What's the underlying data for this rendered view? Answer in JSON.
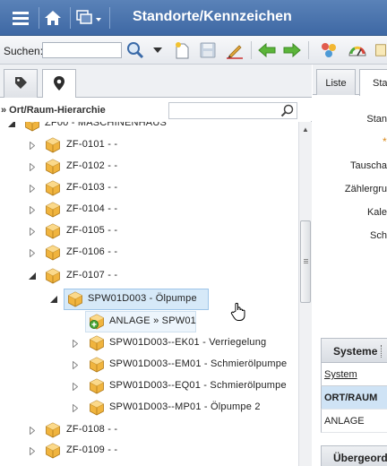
{
  "titlebar": {
    "title": "Standorte/Kennzeichen"
  },
  "toolbar": {
    "search_label": "Suchen:",
    "search_value": ""
  },
  "left_tabs": [
    {
      "icon": "tag-icon",
      "active": false
    },
    {
      "icon": "location-pin-icon",
      "active": true
    }
  ],
  "hierarchy": {
    "title": "» Ort/Raum-Hierarchie",
    "filter_value": "",
    "nodes": [
      {
        "id": "zf00",
        "label": "ZF00 - MASCHINENHAUS",
        "expander": "expanded"
      },
      {
        "id": "zf0101",
        "label": "ZF-0101 - -",
        "expander": "collapsed"
      },
      {
        "id": "zf0102",
        "label": "ZF-0102 - -",
        "expander": "collapsed"
      },
      {
        "id": "zf0103",
        "label": "ZF-0103 - -",
        "expander": "collapsed"
      },
      {
        "id": "zf0104",
        "label": "ZF-0104 - -",
        "expander": "collapsed"
      },
      {
        "id": "zf0105",
        "label": "ZF-0105 - -",
        "expander": "collapsed"
      },
      {
        "id": "zf0106",
        "label": "ZF-0106 - -",
        "expander": "collapsed"
      },
      {
        "id": "zf0107",
        "label": "ZF-0107 - -",
        "expander": "expanded"
      },
      {
        "id": "spw01d003",
        "label": "SPW01D003 - Ölpumpe",
        "expander": "expanded",
        "selected": true
      },
      {
        "id": "anlage",
        "label": "ANLAGE » SPW01",
        "expander": "none"
      },
      {
        "id": "ek01",
        "label": "SPW01D003--EK01 - Verriegelung",
        "expander": "collapsed"
      },
      {
        "id": "em01",
        "label": "SPW01D003--EM01 - Schmierölpumpe",
        "expander": "collapsed"
      },
      {
        "id": "eq01",
        "label": "SPW01D003--EQ01 - Schmierölpumpe",
        "expander": "collapsed"
      },
      {
        "id": "mp01",
        "label": "SPW01D003--MP01 - Ölpumpe 2",
        "expander": "collapsed"
      },
      {
        "id": "zf0108",
        "label": "ZF-0108 - -",
        "expander": "collapsed"
      },
      {
        "id": "zf0109",
        "label": "ZF-0109 - -",
        "expander": "collapsed"
      }
    ]
  },
  "right_tabs": [
    {
      "label": "Liste",
      "active": false
    },
    {
      "label": "Sta",
      "active": true
    }
  ],
  "form_labels": {
    "standort": "Stan",
    "tausch": "Tauscha",
    "zaehler": "Zählergru",
    "kale": "Kale",
    "sch": "Sch"
  },
  "required_marker": "*",
  "systeme": {
    "title": "Systeme",
    "column": "System",
    "rows": [
      "ORT/RAUM",
      "ANLAGE"
    ]
  },
  "uebergeordnet": {
    "title": "Übergeord"
  },
  "colors": {
    "titlebar": "#4a73ad",
    "selection": "#d6e9f8",
    "accent_orange": "#e8a83a"
  }
}
